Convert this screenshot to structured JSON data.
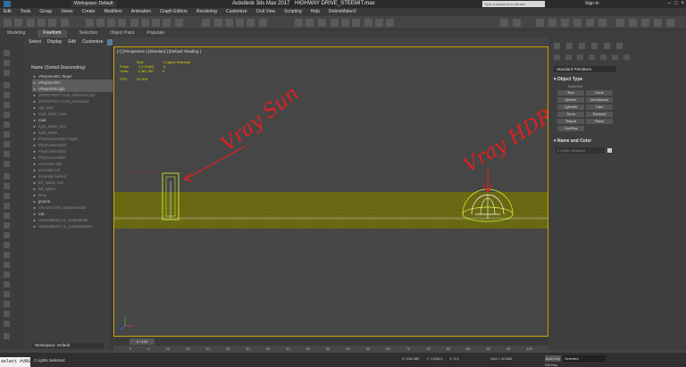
{
  "titlebar": {
    "workspace": "Workspace: Default",
    "app_title": "Autodesk 3ds Max 2017",
    "file_title": "HIGHWAY DRIVE_STEEMIT.max",
    "search_placeholder": "Type a keyword or phrase",
    "sign_in": "Sign In"
  },
  "menu": [
    "Edit",
    "Tools",
    "Group",
    "Views",
    "Create",
    "Modifiers",
    "Animation",
    "Graph Editors",
    "Rendering",
    "Customize",
    "Civil View",
    "Scripting",
    "Help",
    "DebrisMaker2"
  ],
  "ribbon": {
    "tabs": [
      "Modeling",
      "Freeform",
      "Selection",
      "Object Paint",
      "Populate"
    ],
    "active_index": 1
  },
  "scene_explorer": {
    "tabs": [
      "Select",
      "Display",
      "Edit",
      "Customize"
    ],
    "column_header": "Name (Sorted Descending)",
    "rows": [
      {
        "name": "VRaySun001.Target",
        "state": "normal"
      },
      {
        "name": "VRaySun001",
        "state": "selected"
      },
      {
        "name": "VRayHDRILight",
        "state": "selected"
      },
      {
        "name": "ZOON POST CAM_ObserverCam",
        "state": "dim"
      },
      {
        "name": "ZOON POST CAM_Humanoid",
        "state": "dim"
      },
      {
        "name": "sign post",
        "state": "dim"
      },
      {
        "name": "road_dash_main",
        "state": "dim"
      },
      {
        "name": "road",
        "state": "normal"
      },
      {
        "name": "right_spline_tree",
        "state": "dim"
      },
      {
        "name": "right_spline",
        "state": "dim"
      },
      {
        "name": "PhysCamera001.Target",
        "state": "dim"
      },
      {
        "name": "PhysCamera003",
        "state": "dim"
      },
      {
        "name": "PhysCamera002",
        "state": "dim"
      },
      {
        "name": "PhysCamera001",
        "state": "dim"
      },
      {
        "name": "mountain right",
        "state": "dim"
      },
      {
        "name": "mountain left",
        "state": "dim"
      },
      {
        "name": "mountain behind",
        "state": "dim"
      },
      {
        "name": "left_spline_tree",
        "state": "dim"
      },
      {
        "name": "left_spline",
        "state": "dim"
      },
      {
        "name": "lamp",
        "state": "dim"
      },
      {
        "name": "ground",
        "state": "normal"
      },
      {
        "name": "CRASH CAM_ObserverCam",
        "state": "dim"
      },
      {
        "name": "Car",
        "state": "normal"
      },
      {
        "name": "AtHeadsEXd_01_TargetMesh",
        "state": "dim"
      },
      {
        "name": "AtHeadsEXd_01_CarBodyMesh",
        "state": "dim"
      }
    ],
    "workspace": "Workspace: Default"
  },
  "viewport": {
    "label": "[+] [Perspective ] [Standard ] [Default Shading ]",
    "stats": {
      "header_left": "Total",
      "header_right": "2 Lights Selected",
      "polys_label": "Polys:",
      "polys_total": "2,276,882",
      "polys_sel": "0",
      "verts_label": "Verts:",
      "verts_total": "1,381,387",
      "verts_sel": "0",
      "fps_label": "FPS:",
      "fps_value": "92.909"
    },
    "annotation_sun": "Vray Sun",
    "annotation_hdri": "Vray HDRI"
  },
  "command_panel": {
    "dropdown": "Standard Primitives",
    "object_type_title": "Object Type",
    "autogrid": "AutoGrid",
    "primitives": [
      "Box",
      "Cone",
      "Sphere",
      "GeoSphere",
      "Cylinder",
      "Tube",
      "Torus",
      "Pyramid",
      "Teapot",
      "Plane",
      "TextPlus"
    ],
    "name_color_title": "Name and Color",
    "selection_name": "2 Lights Selected"
  },
  "timeline": {
    "slider": "0 / 100",
    "ticks": [
      "0",
      "5",
      "10",
      "15",
      "20",
      "25",
      "30",
      "35",
      "40",
      "45",
      "50",
      "55",
      "60",
      "65",
      "70",
      "75",
      "80",
      "85",
      "90",
      "95",
      "100"
    ]
  },
  "status": {
    "maxscript": "select #VRS",
    "prompt": "2 Lights Selected",
    "x": "X: 236.389",
    "y": "Y: 1,828.3",
    "z": "Z: 0.0",
    "grid": "Grid = 40.669",
    "autokey": "Auto Key",
    "selected": "Selected",
    "setkey": "Set Key"
  },
  "colors": {
    "viewport_border": "#c8a000",
    "ground_plane": "#6b6a10",
    "annotation": "#e02020",
    "light_gizmo": "#d8ff30"
  }
}
